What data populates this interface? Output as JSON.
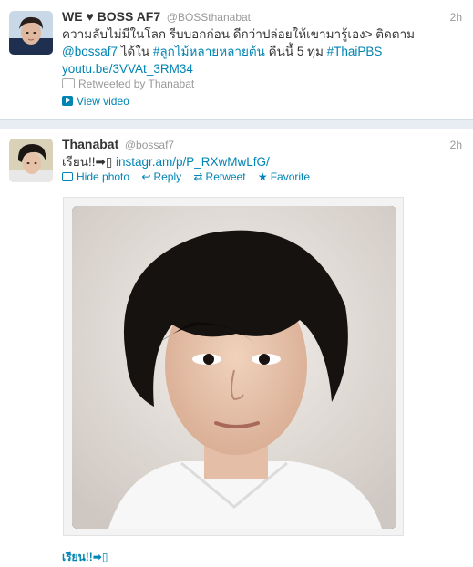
{
  "tweet1": {
    "name": "WE ♥ BOSS AF7",
    "handle": "@BOSSthanabat",
    "time": "2h",
    "text_part1": "ความลับไม่มีในโลก รีบบอกก่อน ดีกว่าปล่อยให้เขามารู้เอง> ติดตาม ",
    "mention": "@bossaf7",
    "text_part2": " ได้ใน ",
    "hashtag1": "#ลูกไม้หลายหลายต้น",
    "text_part3": " คืนนี้ 5 ทุ่ม ",
    "hashtag2": "#ThaiPBS",
    "link": "youtu.be/3VVAt_3RM34",
    "retweeted_by": "Retweeted by Thanabat",
    "view_video": "View video",
    "avatar_icon": "avatar-photo"
  },
  "tweet2": {
    "name": "Thanabat",
    "handle": "@bossaf7",
    "time": "2h",
    "text": "เรียน!!➡▯ ",
    "link": "instagr.am/p/P_RXwMwLfG/",
    "actions": {
      "hide_photo": "Hide photo",
      "reply": "Reply",
      "retweet": "Retweet",
      "favorite": "Favorite"
    },
    "icons": {
      "reply": "↩",
      "retweet": "⇄",
      "favorite": "★"
    },
    "caption": "เรียน!!➡▯",
    "avatar_icon": "avatar-photo"
  },
  "colors": {
    "link": "#0084b4",
    "muted": "#999999",
    "divider": "#e7edf2"
  }
}
